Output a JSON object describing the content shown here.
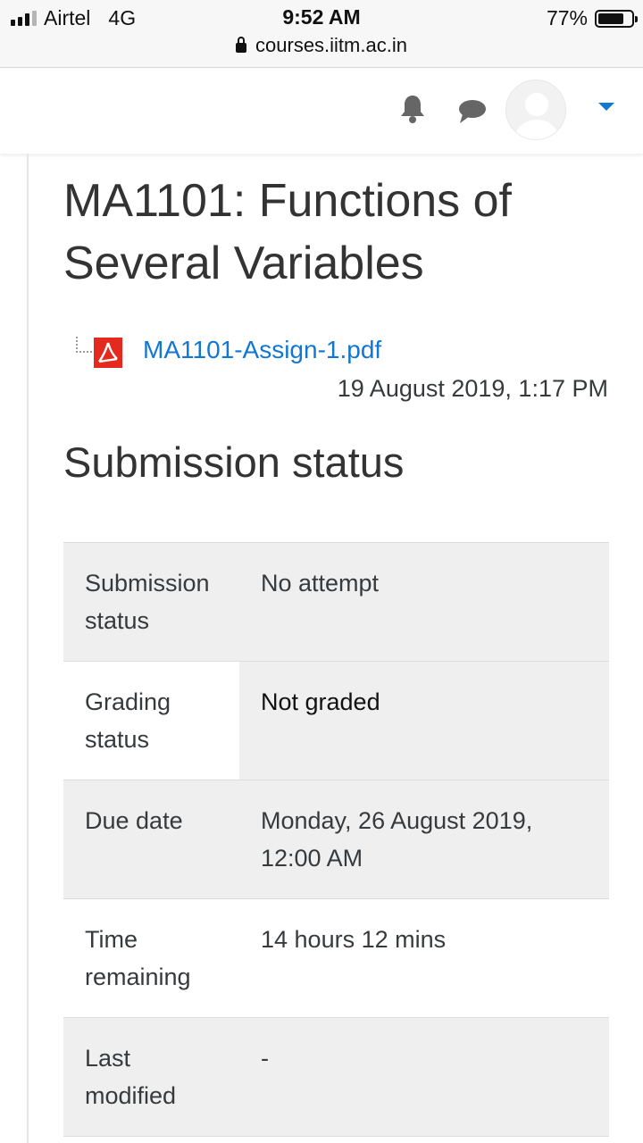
{
  "status_bar": {
    "carrier": "Airtel",
    "network": "4G",
    "time": "9:52 AM",
    "battery": "77%",
    "battery_level": 0.77,
    "signal_bars": 4,
    "signal_strength": 3
  },
  "url_bar": {
    "domain": "courses.iitm.ac.in"
  },
  "navbar": {
    "icons": [
      "bell-icon",
      "chat-icon",
      "avatar",
      "caret-down-icon"
    ],
    "accent_color": "#1177d1"
  },
  "page": {
    "title": "MA1101: Functions of Several Variables",
    "attachment": {
      "filename": "MA1101-Assign-1.pdf",
      "icon": "pdf-icon",
      "date": "19 August 2019, 1:17 PM"
    },
    "section_heading": "Submission status",
    "status_table": [
      {
        "label": "Submission status",
        "value": "No attempt"
      },
      {
        "label": "Grading status",
        "value": "Not graded"
      },
      {
        "label": "Due date",
        "value": "Monday, 26 August 2019, 12:00 AM"
      },
      {
        "label": "Time remaining",
        "value": "14 hours 12 mins"
      },
      {
        "label": "Last modified",
        "value": "-"
      }
    ]
  }
}
